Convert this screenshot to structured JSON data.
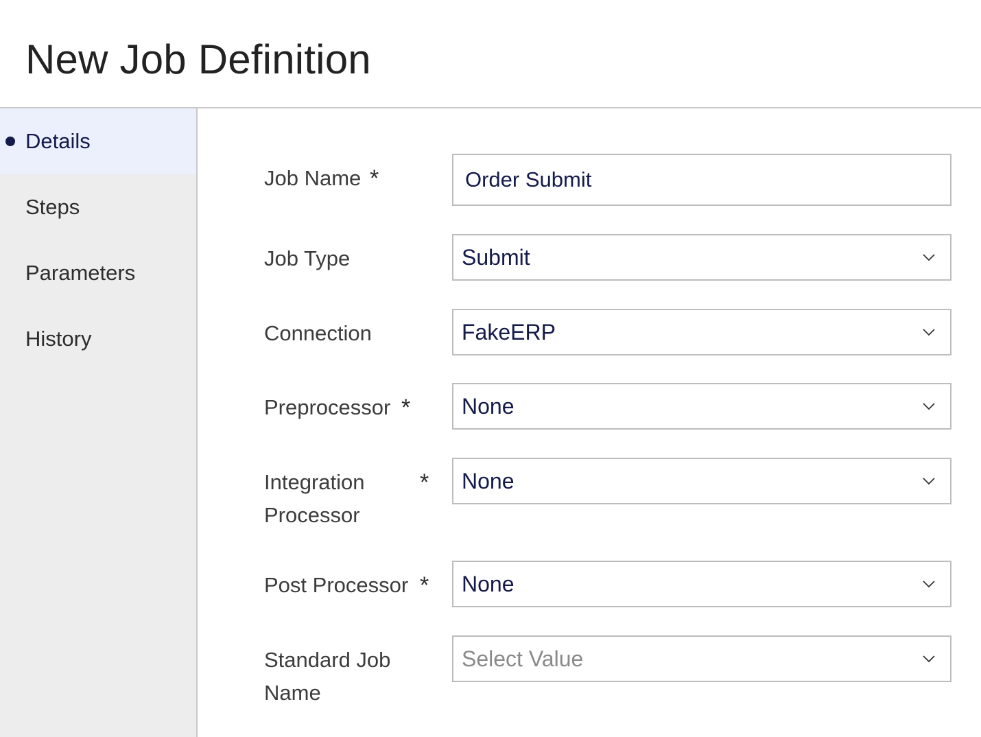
{
  "page": {
    "title": "New Job Definition"
  },
  "sidebar": {
    "items": [
      {
        "label": "Details",
        "active": true
      },
      {
        "label": "Steps",
        "active": false
      },
      {
        "label": "Parameters",
        "active": false
      },
      {
        "label": "History",
        "active": false
      }
    ]
  },
  "form": {
    "required_marker": "*",
    "job_name": {
      "label": "Job Name",
      "value": "Order Submit",
      "required": true
    },
    "job_type": {
      "label": "Job Type",
      "value": "Submit",
      "required": false
    },
    "connection": {
      "label": "Connection",
      "value": "FakeERP",
      "required": false
    },
    "preprocessor": {
      "label": "Preprocessor",
      "value": "None",
      "required": true
    },
    "integration_processor": {
      "label_line1": "Integration",
      "label_line2": "Processor",
      "value": "None",
      "required": true
    },
    "post_processor": {
      "label": "Post Processor",
      "value": "None",
      "required": true
    },
    "standard_job_name": {
      "label_line1": "Standard Job",
      "label_line2": "Name",
      "placeholder": "Select Value",
      "required": false
    }
  },
  "icons": {
    "select": "chevron-down-icon",
    "active_indicator": "bullet-dot-icon"
  },
  "colors": {
    "accent": "#141a4a",
    "active_nav_bg": "#eceffc",
    "sidebar_bg": "#ededed",
    "border": "#bdbdbd"
  }
}
